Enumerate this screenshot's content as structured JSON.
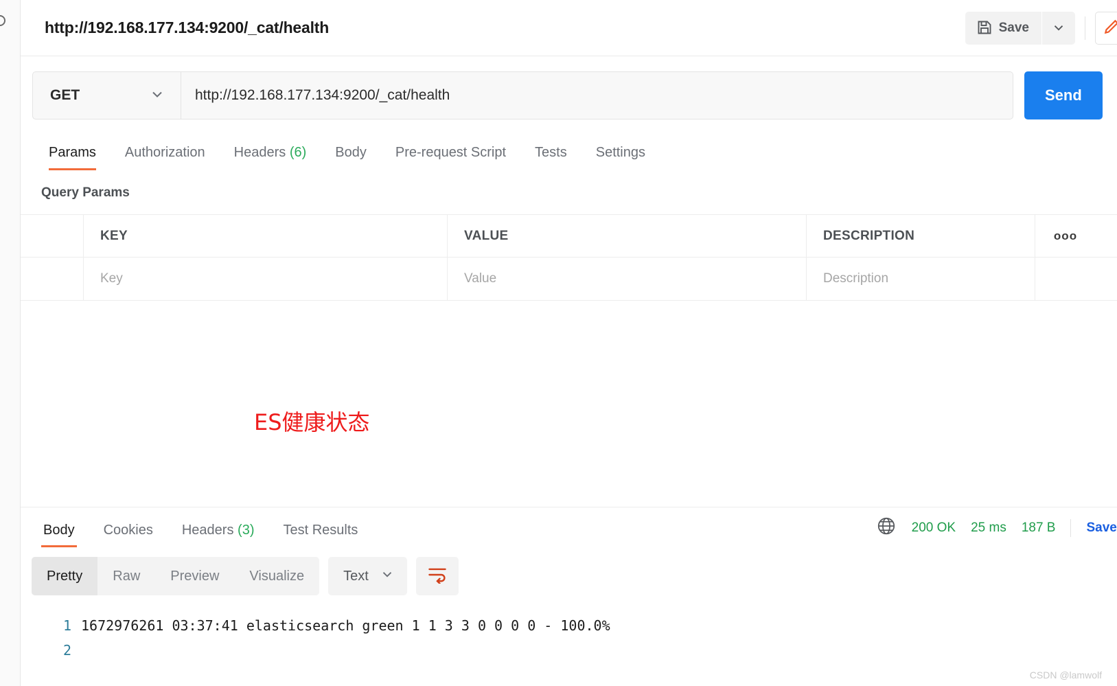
{
  "request": {
    "title": "http://192.168.177.134:9200/_cat/health",
    "method": "GET",
    "url": "http://192.168.177.134:9200/_cat/health",
    "send_label": "Send",
    "save_label": "Save",
    "tabs": [
      {
        "label": "Params",
        "count": "",
        "active": true
      },
      {
        "label": "Authorization",
        "count": "",
        "active": false
      },
      {
        "label": "Headers",
        "count": "(6)",
        "active": false
      },
      {
        "label": "Body",
        "count": "",
        "active": false
      },
      {
        "label": "Pre-request Script",
        "count": "",
        "active": false
      },
      {
        "label": "Tests",
        "count": "",
        "active": false
      },
      {
        "label": "Settings",
        "count": "",
        "active": false
      }
    ]
  },
  "params": {
    "section_title": "Query Params",
    "columns": [
      "KEY",
      "VALUE",
      "DESCRIPTION"
    ],
    "bulk_edit_glyph": "ooo",
    "placeholders": {
      "key": "Key",
      "value": "Value",
      "description": "Description"
    }
  },
  "annotation": {
    "text": "ES健康状态",
    "color": "#ee1c1c"
  },
  "response": {
    "tabs": [
      {
        "label": "Body",
        "count": "",
        "active": true
      },
      {
        "label": "Cookies",
        "count": "",
        "active": false
      },
      {
        "label": "Headers",
        "count": "(3)",
        "active": false
      },
      {
        "label": "Test Results",
        "count": "",
        "active": false
      }
    ],
    "status": "200 OK",
    "time": "25 ms",
    "size": "187 B",
    "save_response_label": "Save Res",
    "format_tabs": [
      {
        "label": "Pretty",
        "active": true
      },
      {
        "label": "Raw",
        "active": false
      },
      {
        "label": "Preview",
        "active": false
      },
      {
        "label": "Visualize",
        "active": false
      }
    ],
    "content_type": "Text",
    "body_lines": [
      {
        "num": "1",
        "text": "1672976261 03:37:41 elasticsearch green 1 1 3 3 0 0 0 0 - 100.0%"
      },
      {
        "num": "2",
        "text": ""
      }
    ]
  },
  "watermark": "CSDN @lamwolf",
  "colors": {
    "accent": "#f26b3a",
    "send": "#1a7fee",
    "success": "#1f9c4a",
    "link": "#1a5fe0"
  }
}
